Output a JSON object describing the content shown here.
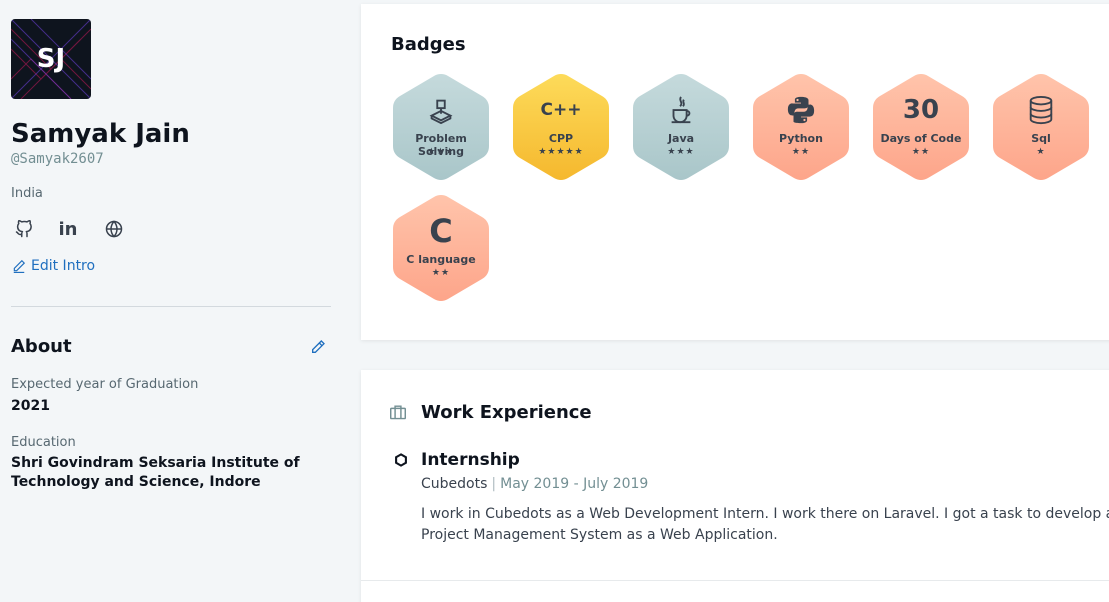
{
  "profile": {
    "initials": "SJ",
    "name": "Samyak Jain",
    "handle": "@Samyak2607",
    "country": "India",
    "edit_intro_label": "Edit Intro"
  },
  "social_icons": [
    "github-icon",
    "linkedin-icon",
    "globe-icon"
  ],
  "about": {
    "title": "About",
    "graduation_label": "Expected year of Graduation",
    "graduation_value": "2021",
    "education_label": "Education",
    "education_value": "Shri Govindram Seksaria Institute of Technology and Science, Indore"
  },
  "badges": {
    "title": "Badges",
    "items": [
      {
        "label": "Problem Solving",
        "stars": "★★★",
        "icon": "code-icon",
        "theme": "silver"
      },
      {
        "label": "CPP",
        "stars": "★★★★★",
        "icon": "cpp-icon",
        "theme": "gold",
        "icon_text": "C++"
      },
      {
        "label": "Java",
        "stars": "★★★",
        "icon": "java-icon",
        "theme": "silver"
      },
      {
        "label": "Python",
        "stars": "★★",
        "icon": "python-icon",
        "theme": "bronze"
      },
      {
        "label": "Days of Code",
        "stars": "★★",
        "icon": "days-icon",
        "theme": "bronze",
        "icon_text": "30"
      },
      {
        "label": "Sql",
        "stars": "★",
        "icon": "database-icon",
        "theme": "bronze"
      },
      {
        "label": "C language",
        "stars": "★★",
        "icon": "c-icon",
        "theme": "bronze",
        "icon_text": "C"
      }
    ]
  },
  "experience": {
    "title": "Work Experience",
    "jobs": [
      {
        "title": "Internship",
        "company": "Cubedots",
        "separator": "|",
        "dates": "May 2019 - July 2019",
        "description": "I work in Cubedots as a Web Development Intern. I work there on Laravel. I got a task to develop a Project Management System as a Web Application."
      }
    ]
  },
  "colors": {
    "link": "#1f6fbf",
    "silver_top": "#c5dadc",
    "silver_bottom": "#a9c6c9",
    "gold_top": "#fddb5a",
    "gold_bottom": "#f5b82e",
    "bronze_top": "#ffc4ab",
    "bronze_bottom": "#fda58a"
  }
}
